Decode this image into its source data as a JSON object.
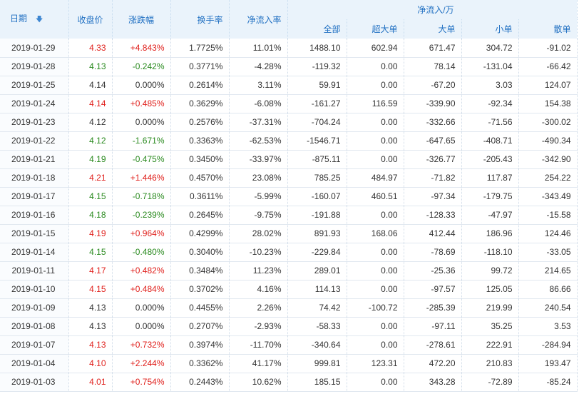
{
  "colors": {
    "up": "#e0201c",
    "down": "#2a8a1f",
    "header_text": "#1f6fc2",
    "header_bg": "#eaf3fb"
  },
  "header": {
    "date": "日期",
    "sort_icon": "sort-down-icon",
    "close": "收盘价",
    "change_pct": "涨跌幅",
    "turnover": "换手率",
    "net_inflow_rate": "净流入率",
    "net_inflow_group": "净流入/万",
    "total": "全部",
    "super_large": "超大单",
    "large": "大单",
    "small": "小单",
    "retail": "散单"
  },
  "rows": [
    {
      "date": "2019-01-29",
      "close": "4.33",
      "change": "+4.843%",
      "dir": "up",
      "turnover": "1.7725%",
      "rate": "11.01%",
      "total": "1488.10",
      "super": "602.94",
      "large": "671.47",
      "small": "304.72",
      "retail": "-91.02"
    },
    {
      "date": "2019-01-28",
      "close": "4.13",
      "change": "-0.242%",
      "dir": "down",
      "turnover": "0.3771%",
      "rate": "-4.28%",
      "total": "-119.32",
      "super": "0.00",
      "large": "78.14",
      "small": "-131.04",
      "retail": "-66.42"
    },
    {
      "date": "2019-01-25",
      "close": "4.14",
      "change": "0.000%",
      "dir": "flat",
      "turnover": "0.2614%",
      "rate": "3.11%",
      "total": "59.91",
      "super": "0.00",
      "large": "-67.20",
      "small": "3.03",
      "retail": "124.07"
    },
    {
      "date": "2019-01-24",
      "close": "4.14",
      "change": "+0.485%",
      "dir": "up",
      "turnover": "0.3629%",
      "rate": "-6.08%",
      "total": "-161.27",
      "super": "116.59",
      "large": "-339.90",
      "small": "-92.34",
      "retail": "154.38"
    },
    {
      "date": "2019-01-23",
      "close": "4.12",
      "change": "0.000%",
      "dir": "flat",
      "turnover": "0.2576%",
      "rate": "-37.31%",
      "total": "-704.24",
      "super": "0.00",
      "large": "-332.66",
      "small": "-71.56",
      "retail": "-300.02"
    },
    {
      "date": "2019-01-22",
      "close": "4.12",
      "change": "-1.671%",
      "dir": "down",
      "turnover": "0.3363%",
      "rate": "-62.53%",
      "total": "-1546.71",
      "super": "0.00",
      "large": "-647.65",
      "small": "-408.71",
      "retail": "-490.34"
    },
    {
      "date": "2019-01-21",
      "close": "4.19",
      "change": "-0.475%",
      "dir": "down",
      "turnover": "0.3450%",
      "rate": "-33.97%",
      "total": "-875.11",
      "super": "0.00",
      "large": "-326.77",
      "small": "-205.43",
      "retail": "-342.90"
    },
    {
      "date": "2019-01-18",
      "close": "4.21",
      "change": "+1.446%",
      "dir": "up",
      "turnover": "0.4570%",
      "rate": "23.08%",
      "total": "785.25",
      "super": "484.97",
      "large": "-71.82",
      "small": "117.87",
      "retail": "254.22"
    },
    {
      "date": "2019-01-17",
      "close": "4.15",
      "change": "-0.718%",
      "dir": "down",
      "turnover": "0.3611%",
      "rate": "-5.99%",
      "total": "-160.07",
      "super": "460.51",
      "large": "-97.34",
      "small": "-179.75",
      "retail": "-343.49"
    },
    {
      "date": "2019-01-16",
      "close": "4.18",
      "change": "-0.239%",
      "dir": "down",
      "turnover": "0.2645%",
      "rate": "-9.75%",
      "total": "-191.88",
      "super": "0.00",
      "large": "-128.33",
      "small": "-47.97",
      "retail": "-15.58"
    },
    {
      "date": "2019-01-15",
      "close": "4.19",
      "change": "+0.964%",
      "dir": "up",
      "turnover": "0.4299%",
      "rate": "28.02%",
      "total": "891.93",
      "super": "168.06",
      "large": "412.44",
      "small": "186.96",
      "retail": "124.46"
    },
    {
      "date": "2019-01-14",
      "close": "4.15",
      "change": "-0.480%",
      "dir": "down",
      "turnover": "0.3040%",
      "rate": "-10.23%",
      "total": "-229.84",
      "super": "0.00",
      "large": "-78.69",
      "small": "-118.10",
      "retail": "-33.05"
    },
    {
      "date": "2019-01-11",
      "close": "4.17",
      "change": "+0.482%",
      "dir": "up",
      "turnover": "0.3484%",
      "rate": "11.23%",
      "total": "289.01",
      "super": "0.00",
      "large": "-25.36",
      "small": "99.72",
      "retail": "214.65"
    },
    {
      "date": "2019-01-10",
      "close": "4.15",
      "change": "+0.484%",
      "dir": "up",
      "turnover": "0.3702%",
      "rate": "4.16%",
      "total": "114.13",
      "super": "0.00",
      "large": "-97.57",
      "small": "125.05",
      "retail": "86.66"
    },
    {
      "date": "2019-01-09",
      "close": "4.13",
      "change": "0.000%",
      "dir": "flat",
      "turnover": "0.4455%",
      "rate": "2.26%",
      "total": "74.42",
      "super": "-100.72",
      "large": "-285.39",
      "small": "219.99",
      "retail": "240.54"
    },
    {
      "date": "2019-01-08",
      "close": "4.13",
      "change": "0.000%",
      "dir": "flat",
      "turnover": "0.2707%",
      "rate": "-2.93%",
      "total": "-58.33",
      "super": "0.00",
      "large": "-97.11",
      "small": "35.25",
      "retail": "3.53"
    },
    {
      "date": "2019-01-07",
      "close": "4.13",
      "change": "+0.732%",
      "dir": "up",
      "turnover": "0.3974%",
      "rate": "-11.70%",
      "total": "-340.64",
      "super": "0.00",
      "large": "-278.61",
      "small": "222.91",
      "retail": "-284.94"
    },
    {
      "date": "2019-01-04",
      "close": "4.10",
      "change": "+2.244%",
      "dir": "up",
      "turnover": "0.3362%",
      "rate": "41.17%",
      "total": "999.81",
      "super": "123.31",
      "large": "472.20",
      "small": "210.83",
      "retail": "193.47"
    },
    {
      "date": "2019-01-03",
      "close": "4.01",
      "change": "+0.754%",
      "dir": "up",
      "turnover": "0.2443%",
      "rate": "10.62%",
      "total": "185.15",
      "super": "0.00",
      "large": "343.28",
      "small": "-72.89",
      "retail": "-85.24"
    }
  ]
}
